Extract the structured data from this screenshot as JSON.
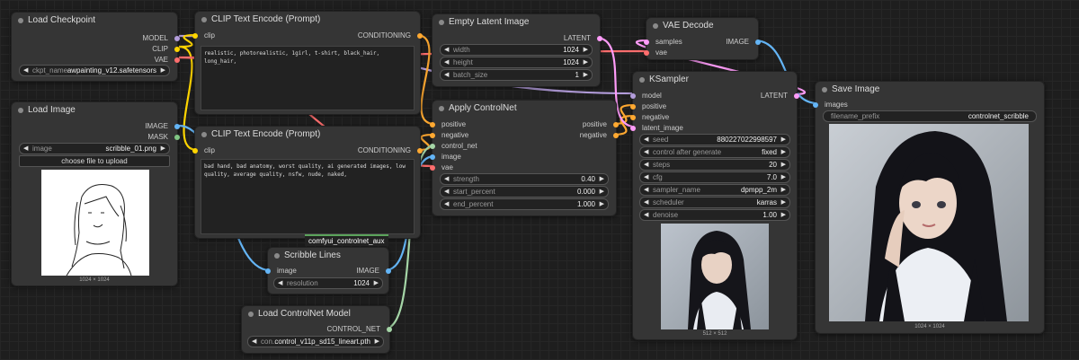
{
  "nodes": {
    "load_checkpoint": {
      "title": "Load Checkpoint",
      "outputs": [
        "MODEL",
        "CLIP",
        "VAE"
      ],
      "ckpt_label": "ckpt_name",
      "ckpt_value": "awpainting_v12.safetensors"
    },
    "load_image": {
      "title": "Load Image",
      "outputs": [
        "IMAGE",
        "MASK"
      ],
      "image_label": "image",
      "image_value": "scribble_01.png",
      "upload_label": "choose file to upload",
      "size_caption": "1024 × 1024"
    },
    "clip_pos": {
      "title": "CLIP Text Encode (Prompt)",
      "input": "clip",
      "output": "CONDITIONING",
      "text": "realistic, photorealistic, 1girl, t-shirt, black_hair, long_hair,"
    },
    "clip_neg": {
      "title": "CLIP Text Encode (Prompt)",
      "input": "clip",
      "output": "CONDITIONING",
      "text": "bad hand, bad anatomy, worst quality, ai generated images, low quality, average quality, nsfw, nude, naked,"
    },
    "group_tag": "comfyui_controlnet_aux",
    "scribble": {
      "title": "Scribble Lines",
      "input": "image",
      "output": "IMAGE",
      "resolution_label": "resolution",
      "resolution_value": "1024"
    },
    "controlnet_loader": {
      "title": "Load ControlNet Model",
      "output": "CONTROL_NET",
      "label": "con...",
      "value": "control_v11p_sd15_lineart.pth"
    },
    "empty_latent": {
      "title": "Empty Latent Image",
      "output": "LATENT",
      "width_label": "width",
      "width_value": "1024",
      "height_label": "height",
      "height_value": "1024",
      "batch_label": "batch_size",
      "batch_value": "1"
    },
    "apply_controlnet": {
      "title": "Apply ControlNet",
      "inputs": [
        "positive",
        "negative",
        "control_net",
        "image",
        "vae"
      ],
      "outputs": [
        "positive",
        "negative"
      ],
      "strength_label": "strength",
      "strength_value": "0.40",
      "start_label": "start_percent",
      "start_value": "0.000",
      "end_label": "end_percent",
      "end_value": "1.000"
    },
    "vae_decode": {
      "title": "VAE Decode",
      "inputs": [
        "samples",
        "vae"
      ],
      "output": "IMAGE"
    },
    "ksampler": {
      "title": "KSampler",
      "inputs": [
        "model",
        "positive",
        "negative",
        "latent_image"
      ],
      "output": "LATENT",
      "widgets": [
        {
          "label": "seed",
          "value": "880227022998597"
        },
        {
          "label": "control after generate",
          "value": "fixed"
        },
        {
          "label": "steps",
          "value": "20"
        },
        {
          "label": "cfg",
          "value": "7.0"
        },
        {
          "label": "sampler_name",
          "value": "dpmpp_2m"
        },
        {
          "label": "scheduler",
          "value": "karras"
        },
        {
          "label": "denoise",
          "value": "1.00"
        }
      ],
      "size_caption": "512 × 512"
    },
    "save_image": {
      "title": "Save Image",
      "input": "images",
      "prefix_label": "filename_prefix",
      "prefix_value": "controlnet_scribble",
      "size_caption": "1024 × 1024"
    }
  },
  "colors": {
    "model": "#b39ddb",
    "clip": "#ffd500",
    "vae": "#ff6e6e",
    "conditioning": "#ffa931",
    "latent": "#ff9cf9",
    "image": "#64b5f6",
    "control_net": "#a5d6a7",
    "mask": "#81c784"
  }
}
